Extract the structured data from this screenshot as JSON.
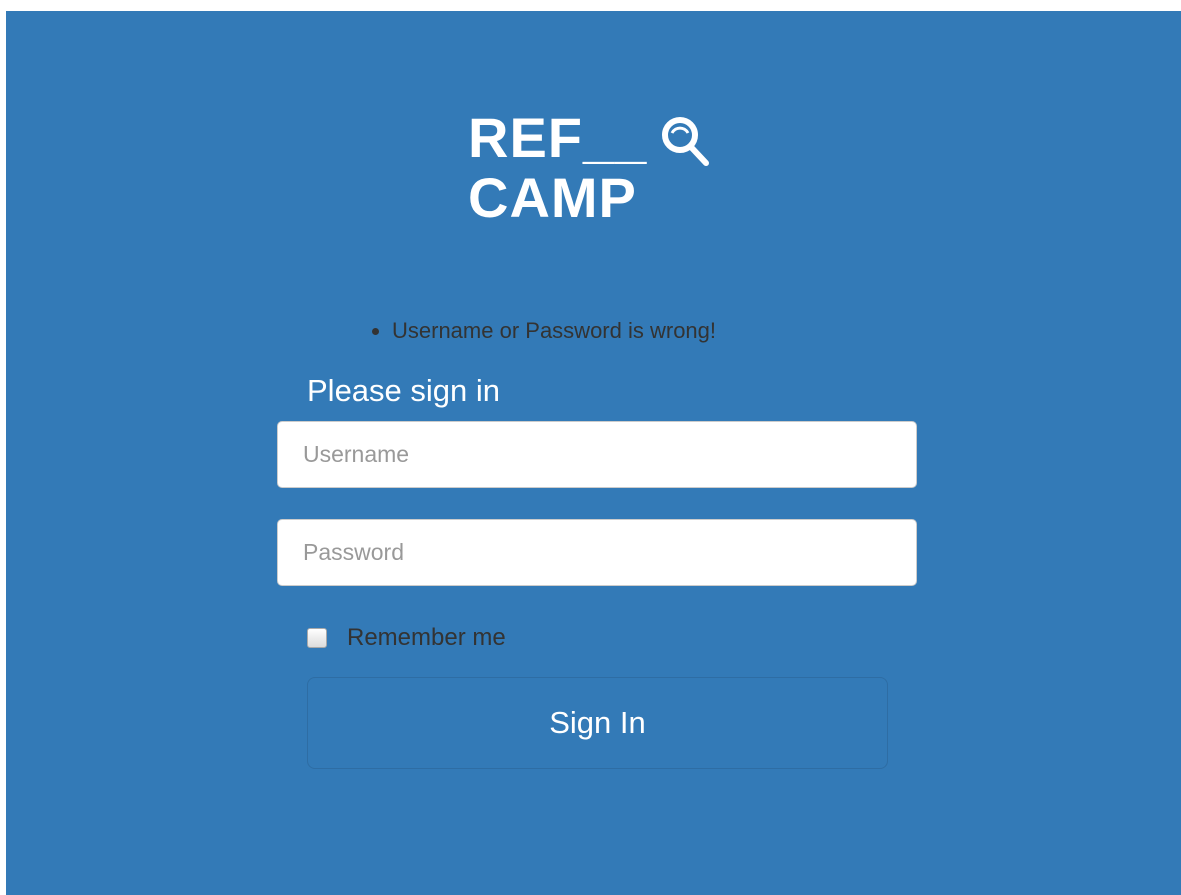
{
  "logo": {
    "line1": "REF__",
    "line2": "CAMP",
    "icon": "magnifier-icon"
  },
  "errors": [
    "Username or Password is wrong!"
  ],
  "form": {
    "title": "Please sign in",
    "username_placeholder": "Username",
    "username_value": "",
    "password_placeholder": "Password",
    "password_value": "",
    "remember_label": "Remember me",
    "remember_checked": false,
    "submit_label": "Sign In"
  },
  "colors": {
    "background": "#337ab7",
    "text_on_primary": "#ffffff",
    "error_text": "#333333"
  }
}
